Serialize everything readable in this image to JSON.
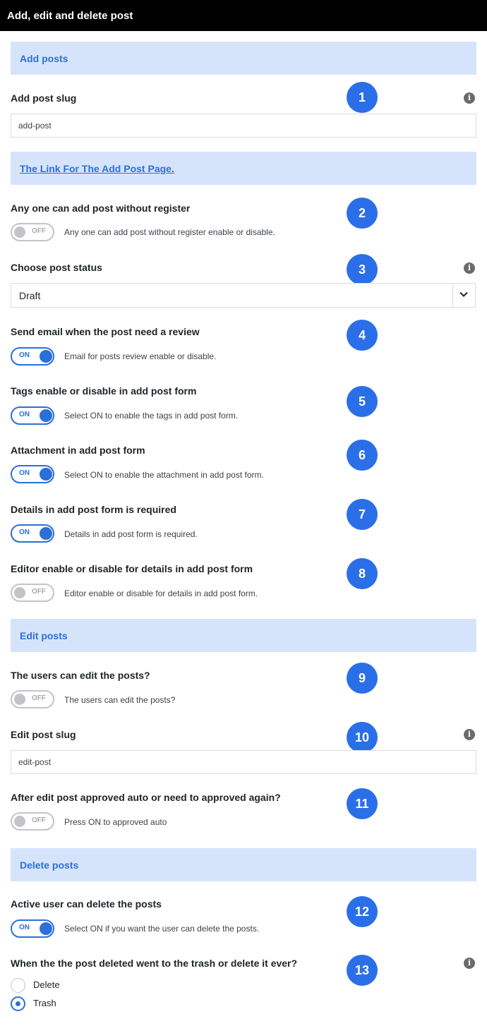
{
  "window": {
    "title": "Add, edit and delete post"
  },
  "sections": {
    "add_posts": "Add posts",
    "add_post_link": "The Link For The Add Post Page.",
    "edit_posts": "Edit posts",
    "delete_posts": "Delete posts"
  },
  "fields": {
    "add_post_slug": {
      "label": "Add post slug",
      "value": "add-post"
    },
    "anyone_add": {
      "label": "Any one can add post without register",
      "state": "OFF",
      "description": "Any one can add post without register enable or disable."
    },
    "post_status": {
      "label": "Choose post status",
      "selected": "Draft"
    },
    "send_email": {
      "label": "Send email when the post need a review",
      "state": "ON",
      "description": "Email for posts review enable or disable."
    },
    "tags": {
      "label": "Tags enable or disable in add post form",
      "state": "ON",
      "description": "Select ON to enable the tags in add post form."
    },
    "attachment": {
      "label": "Attachment in add post form",
      "state": "ON",
      "description": "Select ON to enable the attachment in add post form."
    },
    "details_required": {
      "label": "Details in add post form is required",
      "state": "ON",
      "description": "Details in add post form is required."
    },
    "editor": {
      "label": "Editor enable or disable for details in add post form",
      "state": "OFF",
      "description": "Editor enable or disable for details in add post form."
    },
    "users_edit": {
      "label": "The users can edit the posts?",
      "state": "OFF",
      "description": "The users can edit the posts?"
    },
    "edit_post_slug": {
      "label": "Edit post slug",
      "value": "edit-post"
    },
    "approve_auto": {
      "label": "After edit post approved auto or need to approved again?",
      "state": "OFF",
      "description": "Press ON to approved auto"
    },
    "user_delete": {
      "label": "Active user can delete the posts",
      "state": "ON",
      "description": "Select ON if you want the user can delete the posts."
    },
    "trash_or_delete": {
      "label": "When the the post deleted went to the trash or delete it ever?",
      "options": [
        "Delete",
        "Trash"
      ],
      "selected": "Trash"
    }
  },
  "badges": [
    "1",
    "2",
    "3",
    "4",
    "5",
    "6",
    "7",
    "8",
    "9",
    "10",
    "11",
    "12",
    "13"
  ],
  "icons": {
    "info": "i"
  },
  "colors": {
    "accent": "#2b6fd9",
    "badge": "#2b6fe8",
    "section_bg": "#d6e4fb",
    "header_bg": "#000000"
  }
}
